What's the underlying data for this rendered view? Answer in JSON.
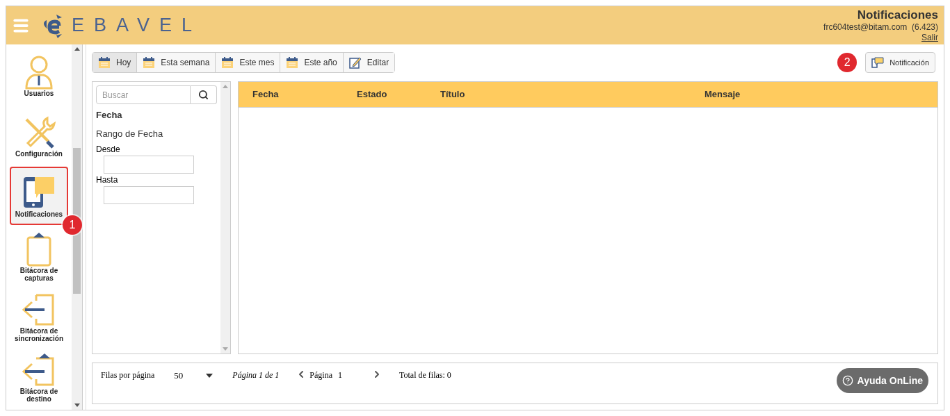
{
  "header": {
    "logo_text": "EBAVEL",
    "page_title": "Notificaciones",
    "user": "frc604test@bitam.com  (6.423)",
    "logout": "Salir"
  },
  "sidebar": {
    "items": [
      {
        "kind": "user",
        "label": "Usuarios",
        "selected": false
      },
      {
        "kind": "tools",
        "label": "Configuración",
        "selected": false
      },
      {
        "kind": "tablet",
        "label": "Notificaciones",
        "selected": true,
        "callout": "1"
      },
      {
        "kind": "clipboard",
        "label": "Bitácora de capturas",
        "selected": false
      },
      {
        "kind": "exit",
        "label": "Bitácora de sincronización",
        "selected": false
      },
      {
        "kind": "exit-clip",
        "label": "Bitácora de destino",
        "selected": false
      }
    ]
  },
  "toolbar": {
    "buttons": [
      {
        "kind": "day",
        "label": "Hoy",
        "selected": true
      },
      {
        "kind": "week",
        "label": "Esta semana",
        "selected": false
      },
      {
        "kind": "month",
        "label": "Este mes",
        "selected": false
      },
      {
        "kind": "year",
        "label": "Este año",
        "selected": false
      },
      {
        "kind": "edit",
        "label": "Editar",
        "selected": false
      }
    ],
    "new_button": {
      "label": "Notificación",
      "callout": "2"
    }
  },
  "filters": {
    "search": {
      "placeholder": "Buscar"
    },
    "section": "Fecha",
    "range": "Rango de Fecha",
    "from": "Desde",
    "to": "Hasta"
  },
  "table": {
    "columns": [
      "Fecha",
      "Estado",
      "Título",
      "Mensaje"
    ]
  },
  "pager": {
    "rows_label": "Filas por página",
    "rows_value": "50",
    "page_of": "Página 1 de 1",
    "page_label": "Página",
    "page_value": "1",
    "total": "Total de filas: 0"
  },
  "help_button": {
    "label": "Ayuda OnLine"
  }
}
